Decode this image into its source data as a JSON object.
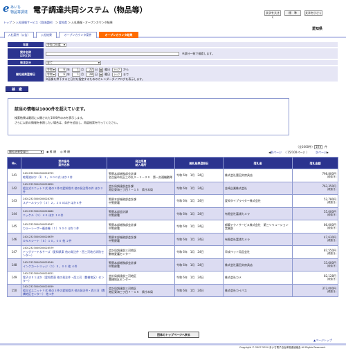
{
  "header": {
    "logo_mark": "e",
    "logo_line1": "あいち",
    "logo_line2": "物品等調達",
    "title": "電子調達共同システム（物品等）",
    "font_size": [
      "文字を大きく",
      "標　準",
      "文字を小さく"
    ],
    "prefecture": "愛知県"
  },
  "breadcrumb": [
    "トップ",
    "入札情報サービス（団体選択）",
    "愛知県",
    "入札情報・オープンカウンタ結果"
  ],
  "tabs": [
    "入札案件（公告）",
    "入札結果",
    "オープンカウンタ案件",
    "オープンカウンタ結果"
  ],
  "search": {
    "year_label": "年度",
    "year_value": "令和 5年度",
    "name_label": "案件名称",
    "name_sub": "（20文字）",
    "name_value": "",
    "name_note": "※部分一致で検索します。",
    "type_label": "発注区分",
    "type_value": "全て",
    "date_label": "開札結果登録日",
    "from": {
      "era": "令和",
      "year": "6",
      "month": "1",
      "day": "22"
    },
    "to": {
      "era": "令和",
      "year": "6",
      "month": "1",
      "day": "28"
    },
    "unit_year": "年",
    "unit_month": "月",
    "unit_day": "日",
    "weekday_from": "曜日",
    "weekday_to": "曜日",
    "clear": "クリア",
    "from_word": "から",
    "to_word": "まで",
    "cal_note": "※画像を押下すると日付を指定するためのカレンダーダイアログを表示します。",
    "button": "検　索"
  },
  "notice": {
    "title": "該当の情報は1000件を超えています。",
    "line1": "検索結果は最初に公開された1000件のみを表示します。",
    "line2": "さらに以前の情報を参照したい場合は、条件を追加し、再度検索を行ってください。"
  },
  "controls": {
    "sort_value": "開札結果登録日",
    "asc": "昇 順",
    "desc": "降 順",
    "total": "全1000件",
    "per_page": "10",
    "per_page_unit": "件",
    "prev": "前ページ",
    "page_info": "（ 15/100ページ ）",
    "next": "次ページ"
  },
  "table": {
    "headers": {
      "no": "No.",
      "case": "案件番号\n案件名称",
      "org": "発注序属\n納入場所",
      "date": "開札結果登録日",
      "winner": "落札者",
      "amount": "落札金額"
    },
    "rows": [
      {
        "no": "141",
        "num": "24012323000000028793",
        "name": "乾電池ほか（1）１，０００式 ほか３件",
        "org1": "警察本部総務部会計課",
        "org2": "名古屋市丸区三の丸２－１－２０　第一交通機動隊",
        "date": "令和 6年　1月　24日",
        "winner": "株式会社富田文房具店",
        "amount": "798,800円",
        "tax": "(税抜き)"
      },
      {
        "no": "142",
        "num": "24012323000000028820",
        "name": "組立式ユニットＹ式 他の３件の愛知県内 他の発注等の件 ほか２件",
        "org1": "会計局調達部会計課",
        "org2": "港区東海三丁目７－１５　県庁本局",
        "date": "令和 6年　1月　24日",
        "winner": "金崎企業株式会社",
        "amount": "763,350円",
        "tax": "(税抜き)"
      },
      {
        "no": "143",
        "num": "24012323000000028755",
        "name": "スチールラック（３）２，２００ほか ほか４件",
        "org1": "警察本部総務部会計課",
        "org2": "中警察署",
        "date": "令和 6年　1月　24日",
        "winner": "愛知タイプライター株式会社",
        "amount": "52,780円",
        "tax": "(税抜き)"
      },
      {
        "no": "144",
        "num": "24012323000000028680",
        "name": "ニッケル（１）４０ ほか １０件",
        "org1": "警察本部会計課",
        "org2": "中警察署",
        "date": "令和 6年　1月　24日",
        "winner": "有限会社富浦カメラ",
        "amount": "55,000円",
        "tax": "(税抜き)"
      },
      {
        "no": "145",
        "num": "24012323000000028547",
        "name": "カラーレーザー複合機（１）５００ ほか１件",
        "org1": "警察本部総務部会計課",
        "org2": "中警察署",
        "date": "令和 6年　1月　24日",
        "winner": "都築テクノサービス株式会社　第三ソリューション営業部",
        "amount": "86,000円",
        "tax": "(税抜き)"
      },
      {
        "no": "146",
        "num": "24012323000000028679",
        "name": "ＤＮＡシート（Ｓ）１０，００ 他 ２件",
        "org1": "警察本部総務部会計課",
        "org2": "中警察署",
        "date": "令和 6年　1月　24日",
        "winner": "有限会社富浦カメラ",
        "amount": "47,630円",
        "tax": "(税抜き)"
      },
      {
        "no": "147",
        "num": "24012323000000028579",
        "name": "ドッグフード＆サーズ（愛知県東 他の発注件・西三河地方消防センター）",
        "org1": "会計局調達部三河地区",
        "org2": "動物愛護センター",
        "date": "令和 6年　1月　24日",
        "winner": "早成ペット用品会社",
        "amount": "87,550円",
        "tax": "(税抜き)"
      },
      {
        "no": "148",
        "num": "24012323000000028540",
        "name": "インクカートリッジ（１）５，００ 他 ４件",
        "org1": "警察本部総務部会計課",
        "org2": "中警察署",
        "date": "令和 6年　1月　24日",
        "winner": "株式会社富田文房具店",
        "amount": "33,600円",
        "tax": "(税抜き)"
      },
      {
        "no": "149",
        "num": "24012323000000028021",
        "name": "電子き５１ほか（愛知県東 他の発注件・西三河（豊橋地区）センター）",
        "org1": "会計局調達部三河地区",
        "org2": "豊橋地区センター",
        "date": "令和 6年　1月　24日",
        "winner": "株式会社カメ",
        "amount": "82,128円",
        "tax": "(税抜き)"
      },
      {
        "no": "150",
        "num": "24012323000000028059",
        "name": "組立式ユニットＹ式 他の３件の愛知県内 他の発注件・西三河（豊橋地区センター） 他１件",
        "org1": "会計局調達部三河地区",
        "org2": "港区東海三丁目７－１５　県庁本局",
        "date": "令和 6年　1月　24日",
        "winner": "株式会社カイバス",
        "amount": "373,000円",
        "tax": "(税抜き)"
      }
    ]
  },
  "footer": {
    "top_button": "団体のトップページへ戻る",
    "back_top": "▲ページトップ",
    "copyright": "Copyright © 2007-2024 あいち電子自治体推進協議会 All Rights Reserved."
  }
}
